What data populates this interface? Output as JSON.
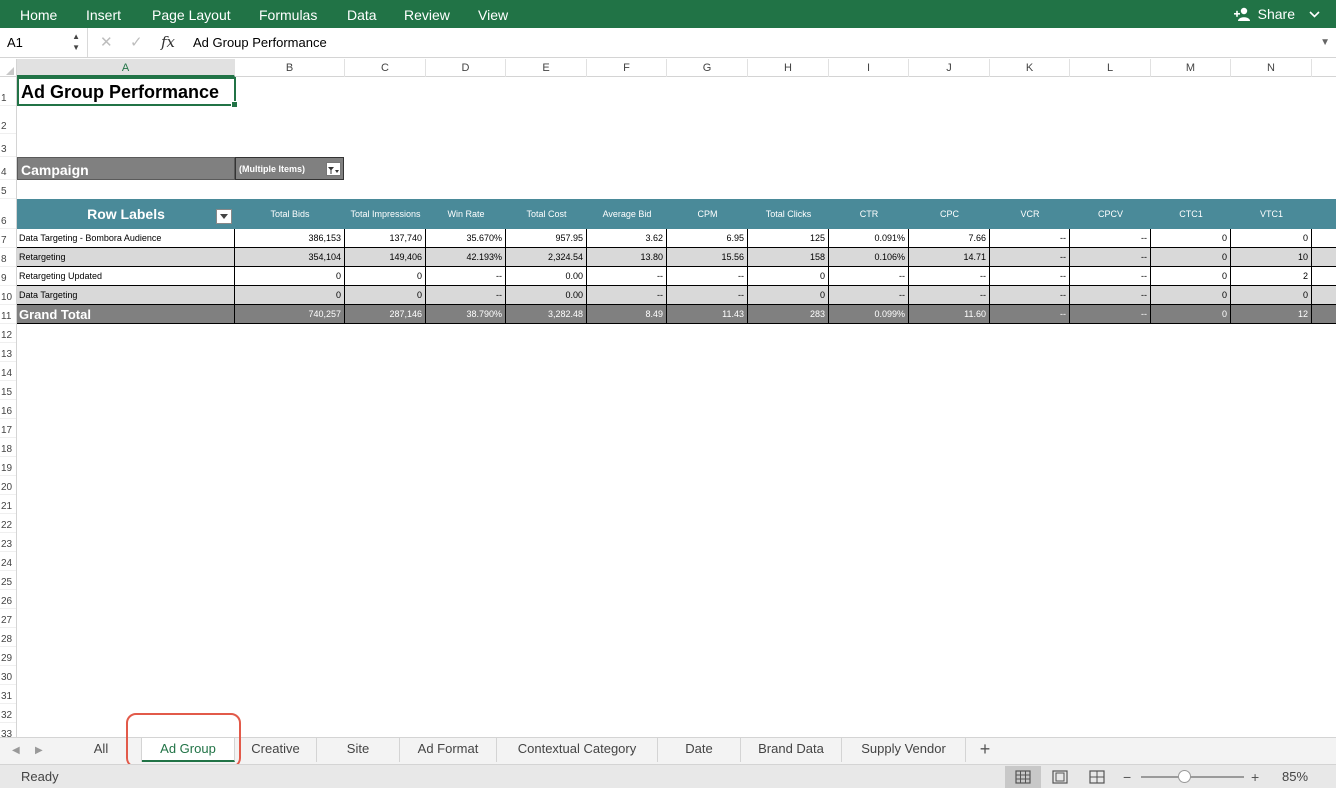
{
  "ribbon": {
    "tabs": [
      "Home",
      "Insert",
      "Page Layout",
      "Formulas",
      "Data",
      "Review",
      "View"
    ],
    "share_label": "Share"
  },
  "formula_bar": {
    "cell_ref": "A1",
    "content": "Ad Group Performance",
    "fx": "fx"
  },
  "columns": [
    "A",
    "B",
    "C",
    "D",
    "E",
    "F",
    "G",
    "H",
    "I",
    "J",
    "K",
    "L",
    "M",
    "N"
  ],
  "rows": [
    "1",
    "2",
    "3",
    "4",
    "5",
    "6",
    "7",
    "8",
    "9",
    "10",
    "11",
    "12",
    "13",
    "14",
    "15",
    "16",
    "17",
    "18",
    "19",
    "20",
    "21",
    "22",
    "23",
    "24",
    "25",
    "26",
    "27",
    "28",
    "29",
    "30",
    "31",
    "32",
    "33"
  ],
  "sheet": {
    "title": "Ad Group Performance",
    "filter": {
      "label": "Campaign",
      "value": "(Multiple Items)"
    },
    "pivot": {
      "headers": [
        "Row Labels",
        "Total Bids",
        "Total Impressions",
        "Win Rate",
        "Total Cost",
        "Average Bid",
        "CPM",
        "Total Clicks",
        "CTR",
        "CPC",
        "VCR",
        "CPCV",
        "CTC1",
        "VTC1"
      ],
      "rows": [
        [
          "Data Targeting - Bombora Audience",
          "386,153",
          "137,740",
          "35.670%",
          "957.95",
          "3.62",
          "6.95",
          "125",
          "0.091%",
          "7.66",
          "--",
          "--",
          "0",
          "0"
        ],
        [
          "Retargeting",
          "354,104",
          "149,406",
          "42.193%",
          "2,324.54",
          "13.80",
          "15.56",
          "158",
          "0.106%",
          "14.71",
          "--",
          "--",
          "0",
          "10"
        ],
        [
          "Retargeting Updated",
          "0",
          "0",
          "--",
          "0.00",
          "--",
          "--",
          "0",
          "--",
          "--",
          "--",
          "--",
          "0",
          "2"
        ],
        [
          "Data Targeting",
          "0",
          "0",
          "--",
          "0.00",
          "--",
          "--",
          "0",
          "--",
          "--",
          "--",
          "--",
          "0",
          "0"
        ]
      ],
      "total": [
        "Grand Total",
        "740,257",
        "287,146",
        "38.790%",
        "3,282.48",
        "8.49",
        "11.43",
        "283",
        "0.099%",
        "11.60",
        "--",
        "--",
        "0",
        "12"
      ]
    }
  },
  "sheet_tabs": [
    "All",
    "Ad Group",
    "Creative",
    "Site",
    "Ad Format",
    "Contextual Category",
    "Date",
    "Brand Data",
    "Supply Vendor"
  ],
  "active_tab": "Ad Group",
  "status": {
    "ready": "Ready",
    "zoom": "85%"
  },
  "colors": {
    "ribbon": "#217346",
    "pivot_header": "#4a8a99",
    "highlight": "#e25a4a"
  }
}
